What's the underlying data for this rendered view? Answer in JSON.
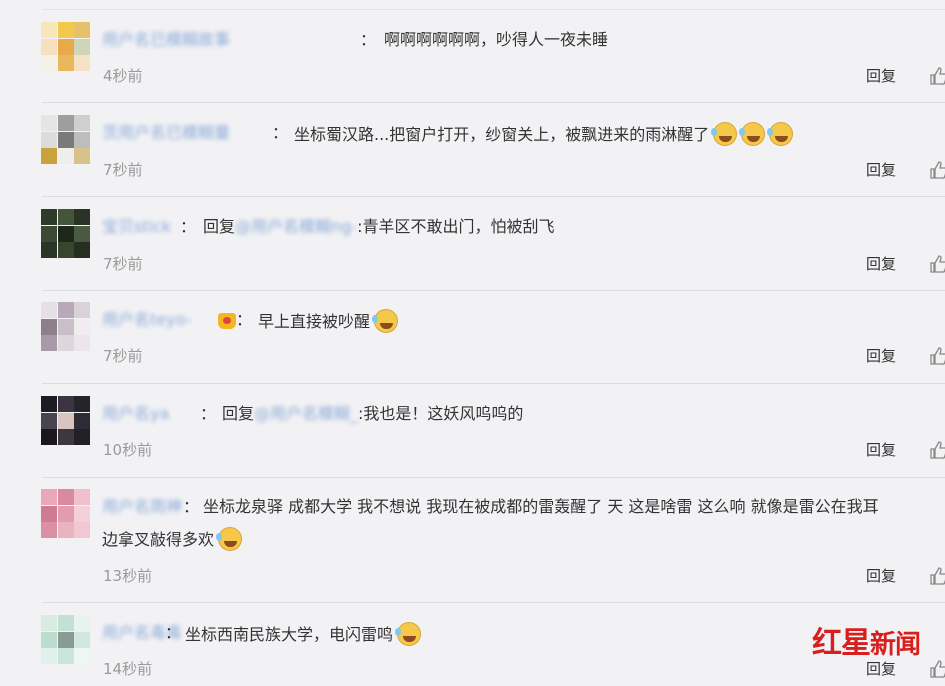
{
  "comments": [
    {
      "username": "用户名已模糊故事",
      "text": "啊啊啊啊啊啊，吵得人一夜未睡",
      "continuation": "",
      "emojis": [],
      "time": "4秒前",
      "reply_label": "回复",
      "avatar_colors": [
        "#f7e7b8",
        "#f2c84d",
        "#e8c06a",
        "#f7e0c0",
        "#e7a94a",
        "#cfd6b8",
        "#f3f0e8",
        "#e9b85c",
        "#f7e2c6"
      ]
    },
    {
      "username": "茨用户名已模糊量",
      "text": "坐标蜀汉路...把窗户打开，纱窗关上，被飘进来的雨淋醒了",
      "continuation": "",
      "emojis": [
        "laugh",
        "laugh",
        "laugh"
      ],
      "time": "7秒前",
      "reply_label": "回复",
      "avatar_colors": [
        "#e5e5e5",
        "#9e9e9e",
        "#cfcfcf",
        "#dcdcdc",
        "#7a7a7a",
        "#bdbdbd",
        "#c9a23c",
        "#eeeeee",
        "#d7c28a"
      ]
    },
    {
      "username": "宝贝stick",
      "text": "回复",
      "mention": "@用户名模糊ng-",
      "after_mention": ":青羊区不敢出门，怕被刮飞",
      "continuation": "",
      "emojis": [],
      "time": "7秒前",
      "reply_label": "回复",
      "avatar_colors": [
        "#2e3b2a",
        "#44553a",
        "#2a3325",
        "#3c4a33",
        "#1f261c",
        "#4a5a40",
        "#2b3526",
        "#38452f",
        "#252e21"
      ]
    },
    {
      "username": "用户名teyo-",
      "text": "早上直接被吵醒",
      "continuation": "",
      "emojis": [
        "laugh"
      ],
      "time": "7秒前",
      "reply_label": "回复",
      "avatar_colors": [
        "#e6e0e6",
        "#b8a8b8",
        "#d9d2d9",
        "#8e7f8c",
        "#c9bfc8",
        "#f0ecf0",
        "#a799a5",
        "#ddd6dc",
        "#eae6ea"
      ]
    },
    {
      "username": "用户名ya",
      "text": "回复",
      "mention": "@用户名模糊_",
      "after_mention": ":我也是！这妖风呜呜的",
      "continuation": "",
      "emojis": [],
      "time": "10秒前",
      "reply_label": "回复",
      "avatar_colors": [
        "#1c1c22",
        "#3a3540",
        "#26232b",
        "#4a4450",
        "#d9c4c0",
        "#2f2b34",
        "#1a181e",
        "#3d3742",
        "#222026"
      ]
    },
    {
      "username": "用户名雨神",
      "text": "坐标龙泉驿 成都大学 我不想说 我现在被成都的雷轰醒了 天 这是啥雷 这么响 就像是雷公在我耳",
      "continuation": "边拿叉敲得多欢",
      "emojis": [
        "cry"
      ],
      "time": "13秒前",
      "reply_label": "回复",
      "avatar_colors": [
        "#e8a8b8",
        "#d98aa0",
        "#f0c0cc",
        "#cf7c93",
        "#e29bb0",
        "#f4d0da",
        "#dc90a6",
        "#eab3c1",
        "#f2c7d2"
      ]
    },
    {
      "username": "用户名毒毒",
      "text": "坐标西南民族大学，电闪雷鸣",
      "continuation": "",
      "emojis": [
        "cry"
      ],
      "time": "14秒前",
      "reply_label": "回复",
      "avatar_colors": [
        "#d8ece4",
        "#c2e0d4",
        "#e6f3ee",
        "#bcdccf",
        "#8a9a94",
        "#d0e8de",
        "#e0f0ea",
        "#cbe5da",
        "#edf6f2"
      ]
    }
  ],
  "like_icon": "thumbs-up-icon",
  "watermark": {
    "part1": "红星",
    "part2": "新闻"
  }
}
